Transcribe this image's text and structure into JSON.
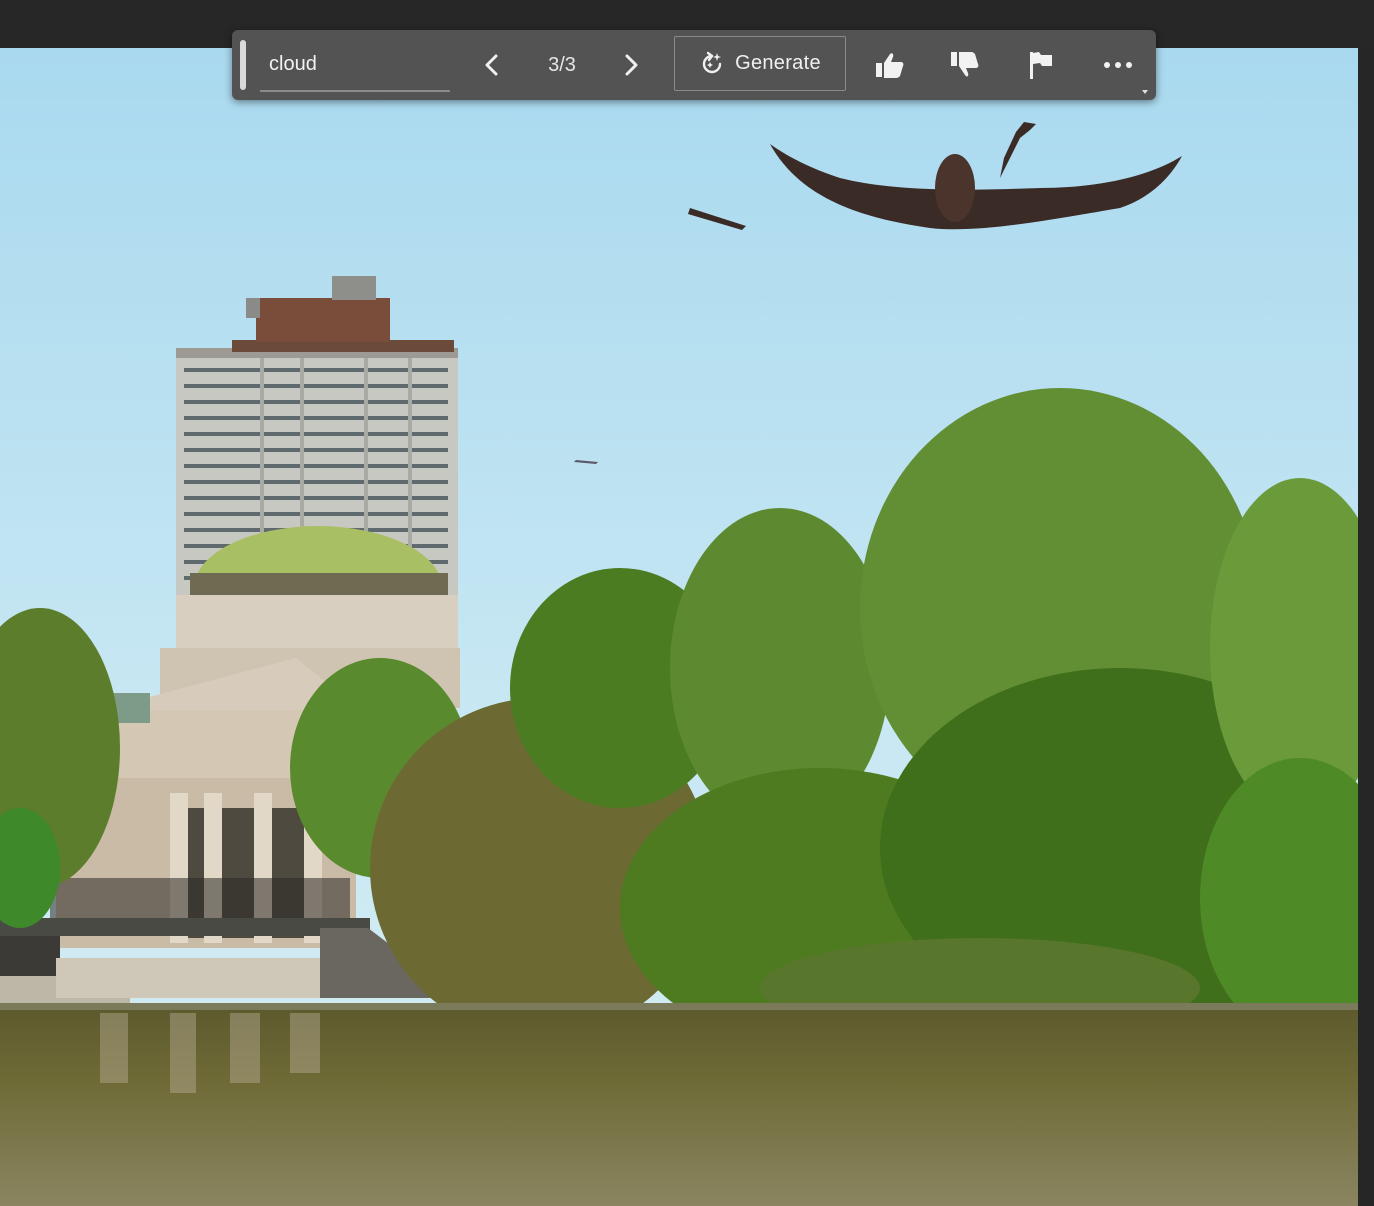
{
  "toolbar": {
    "prompt_value": "cloud",
    "prompt_placeholder": "",
    "counter": "3/3",
    "generate_label": "Generate",
    "icons": {
      "prev": "chevron-left-icon",
      "next": "chevron-right-icon",
      "generate": "generate-refresh-icon",
      "like": "thumbs-up-icon",
      "dislike": "thumbs-down-icon",
      "report": "flag-icon",
      "more": "more-horizontal-icon"
    }
  },
  "colors": {
    "toolbar_bg": "#535353",
    "app_bg": "#272727",
    "sky": "#b8dff0",
    "foliage": "#4f7a24",
    "water": "#6b6630"
  }
}
